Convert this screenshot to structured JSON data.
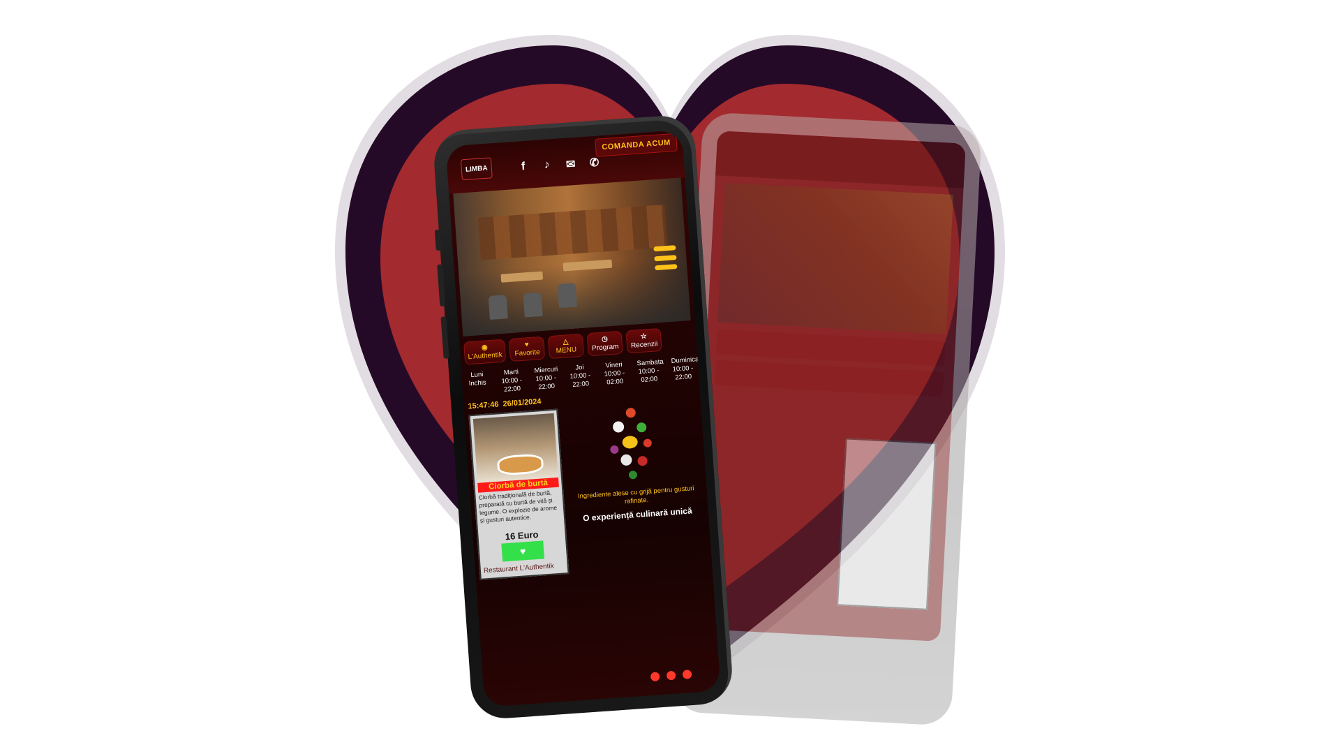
{
  "colors": {
    "heart_outer": "#250a28",
    "heart_inner": "#a32a2e",
    "accent_yellow": "#ffc21a",
    "screen_bg": "#220303",
    "green": "#33e04a",
    "red_title": "#ff1a1a"
  },
  "header": {
    "language_label": "LIMBA",
    "icons": [
      "facebook-icon",
      "tiktok-icon",
      "mail-icon",
      "phone-icon"
    ],
    "icon_glyphs": [
      "f",
      "♪",
      "✉",
      "✆"
    ],
    "cta_label": "COMANDA ACUM"
  },
  "menu_icon": "hamburger-icon",
  "tabs": [
    {
      "label": "L'Authentik",
      "icon": "◉"
    },
    {
      "label": "Favorite",
      "icon": "♥"
    },
    {
      "label": "MENU",
      "icon": "△"
    },
    {
      "label": "Program",
      "icon": "◷"
    },
    {
      "label": "Recenzii",
      "icon": "☆"
    }
  ],
  "hours": [
    {
      "day": "Luni",
      "time": "Inchis"
    },
    {
      "day": "Marti",
      "time": "10:00 - 22:00"
    },
    {
      "day": "Miercuri",
      "time": "10:00 - 22:00"
    },
    {
      "day": "Joi",
      "time": "10:00 - 22:00"
    },
    {
      "day": "Vineri",
      "time": "10:00 - 02:00"
    },
    {
      "day": "Sambata",
      "time": "10:00 - 02:00"
    },
    {
      "day": "Duminica",
      "time": "10:00 - 22:00"
    }
  ],
  "clock": {
    "time": "15:47:46",
    "date": "26/01/2024"
  },
  "product": {
    "title": "Ciorbă de burtă",
    "description": "Ciorbă tradițională de burtă, preparată cu burtă de vită și legume. O explozie de arome și gusturi autentice.",
    "price": "16 Euro",
    "favorite_icon": "♥",
    "footer": "Restaurant L'Authentik"
  },
  "promo": {
    "subtitle": "Ingrediente alese cu grijă pentru gusturi rafinate.",
    "title": "O experiență culinară unică"
  }
}
